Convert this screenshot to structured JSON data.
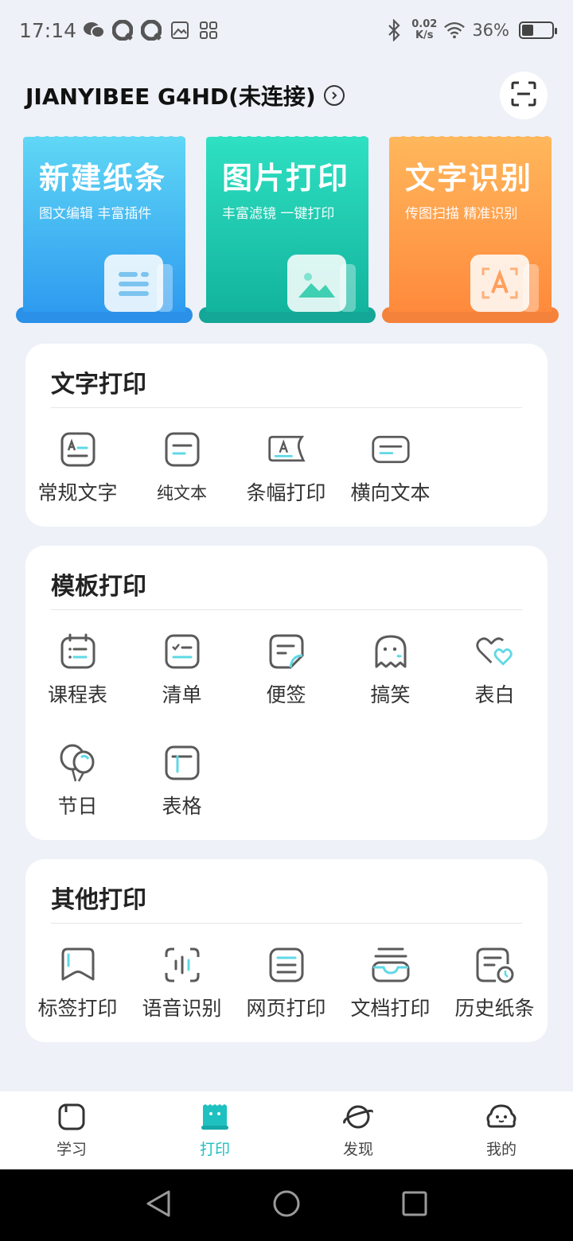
{
  "status_bar": {
    "time": "17:14",
    "net_speed_value": "0.02",
    "net_speed_unit": "K/s",
    "battery": "36%",
    "battery_level": 0.36,
    "left_icons": [
      "wechat-icon",
      "qq-icon",
      "qq-icon",
      "gallery-icon",
      "apps-icon"
    ],
    "right_icons": [
      "bluetooth-icon",
      "wifi-icon",
      "battery-icon"
    ]
  },
  "header": {
    "device_name": "JIANYIBEE G4HD(未连接)",
    "scan_icon": "scan-icon"
  },
  "feature_cards": [
    {
      "title": "新建纸条",
      "subtitle": "图文编辑 丰富插件",
      "icon": "note-icon",
      "color_top": "#5fd7f5",
      "color_bottom": "#2f9bf0",
      "base": "#2a90e8"
    },
    {
      "title": "图片打印",
      "subtitle": "丰富滤镜 一键打印",
      "icon": "image-icon",
      "color_top": "#2fe0c2",
      "color_bottom": "#12b49d",
      "base": "#14a697"
    },
    {
      "title": "文字识别",
      "subtitle": "传图扫描 精准识别",
      "icon": "ocr-icon",
      "color_top": "#ffb75c",
      "color_bottom": "#ff8a3c",
      "base": "#f5823a"
    }
  ],
  "sections": [
    {
      "title": "文字打印",
      "items": [
        {
          "label": "常规文字",
          "icon": "regular-text-icon"
        },
        {
          "label": "纯文本",
          "icon": "plain-text-icon"
        },
        {
          "label": "条幅打印",
          "icon": "banner-print-icon"
        },
        {
          "label": "横向文本",
          "icon": "horizontal-text-icon"
        }
      ]
    },
    {
      "title": "模板打印",
      "items": [
        {
          "label": "课程表",
          "icon": "schedule-icon"
        },
        {
          "label": "清单",
          "icon": "checklist-icon"
        },
        {
          "label": "便签",
          "icon": "sticky-note-icon"
        },
        {
          "label": "搞笑",
          "icon": "ghost-icon"
        },
        {
          "label": "表白",
          "icon": "hearts-icon"
        },
        {
          "label": "节日",
          "icon": "balloons-icon"
        },
        {
          "label": "表格",
          "icon": "table-icon"
        }
      ]
    },
    {
      "title": "其他打印",
      "items": [
        {
          "label": "标签打印",
          "icon": "label-icon"
        },
        {
          "label": "语音识别",
          "icon": "voice-icon"
        },
        {
          "label": "网页打印",
          "icon": "webpage-icon"
        },
        {
          "label": "文档打印",
          "icon": "document-icon"
        },
        {
          "label": "历史纸条",
          "icon": "history-icon"
        }
      ]
    }
  ],
  "bottom_nav": [
    {
      "label": "学习",
      "icon": "study-icon",
      "active": false
    },
    {
      "label": "打印",
      "icon": "print-icon",
      "active": true
    },
    {
      "label": "发现",
      "icon": "planet-icon",
      "active": false
    },
    {
      "label": "我的",
      "icon": "profile-icon",
      "active": false
    }
  ],
  "system_nav": [
    "back-icon",
    "home-icon",
    "recents-icon"
  ],
  "colors": {
    "accent": "#1fc0c0",
    "background": "#eef1f7",
    "icon_stroke": "#5a5a5a",
    "icon_accent": "#5fd8e6"
  }
}
